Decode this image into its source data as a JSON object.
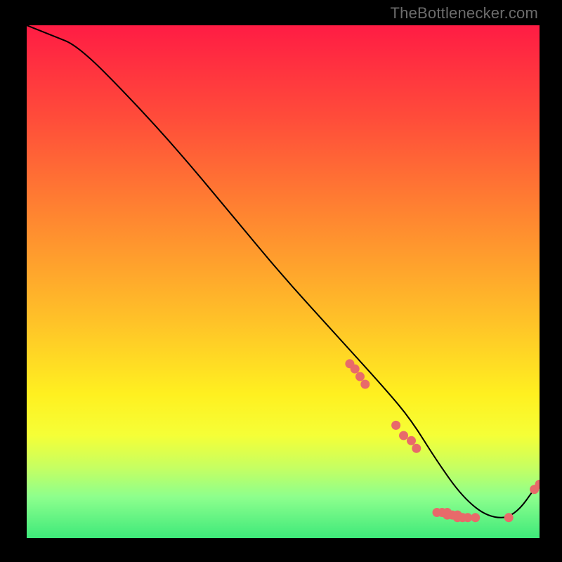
{
  "attribution": "TheBottlenecker.com",
  "chart_data": {
    "type": "line",
    "title": "",
    "xlabel": "",
    "ylabel": "",
    "xlim": [
      0,
      100
    ],
    "ylim": [
      0,
      100
    ],
    "series": [
      {
        "name": "curve",
        "x": [
          0,
          5,
          10,
          20,
          30,
          40,
          50,
          60,
          70,
          75,
          80,
          85,
          90,
          95,
          100
        ],
        "y": [
          100,
          98,
          96,
          86,
          75,
          63,
          51,
          40,
          29,
          23,
          15,
          8,
          4,
          4,
          11
        ]
      }
    ],
    "markers": [
      {
        "x": 63.0,
        "y": 34.0
      },
      {
        "x": 64.0,
        "y": 33.0
      },
      {
        "x": 65.0,
        "y": 31.5
      },
      {
        "x": 66.0,
        "y": 30.0
      },
      {
        "x": 72.0,
        "y": 22.0
      },
      {
        "x": 73.5,
        "y": 20.0
      },
      {
        "x": 75.0,
        "y": 19.0
      },
      {
        "x": 76.0,
        "y": 17.5
      },
      {
        "x": 80.0,
        "y": 5.0
      },
      {
        "x": 81.0,
        "y": 5.0
      },
      {
        "x": 82.0,
        "y": 5.0
      },
      {
        "x": 82.0,
        "y": 4.5
      },
      {
        "x": 83.0,
        "y": 4.5
      },
      {
        "x": 84.0,
        "y": 4.5
      },
      {
        "x": 84.0,
        "y": 4.0
      },
      {
        "x": 85.0,
        "y": 4.0
      },
      {
        "x": 86.0,
        "y": 4.0
      },
      {
        "x": 87.5,
        "y": 4.0
      },
      {
        "x": 94.0,
        "y": 4.0
      },
      {
        "x": 99.0,
        "y": 9.5
      },
      {
        "x": 100.0,
        "y": 10.5
      }
    ],
    "colors": {
      "curve_stroke": "#000000",
      "marker_fill": "#e86a6a",
      "gradient_top": "#ff1c44",
      "gradient_bottom": "#3ee97a"
    }
  }
}
